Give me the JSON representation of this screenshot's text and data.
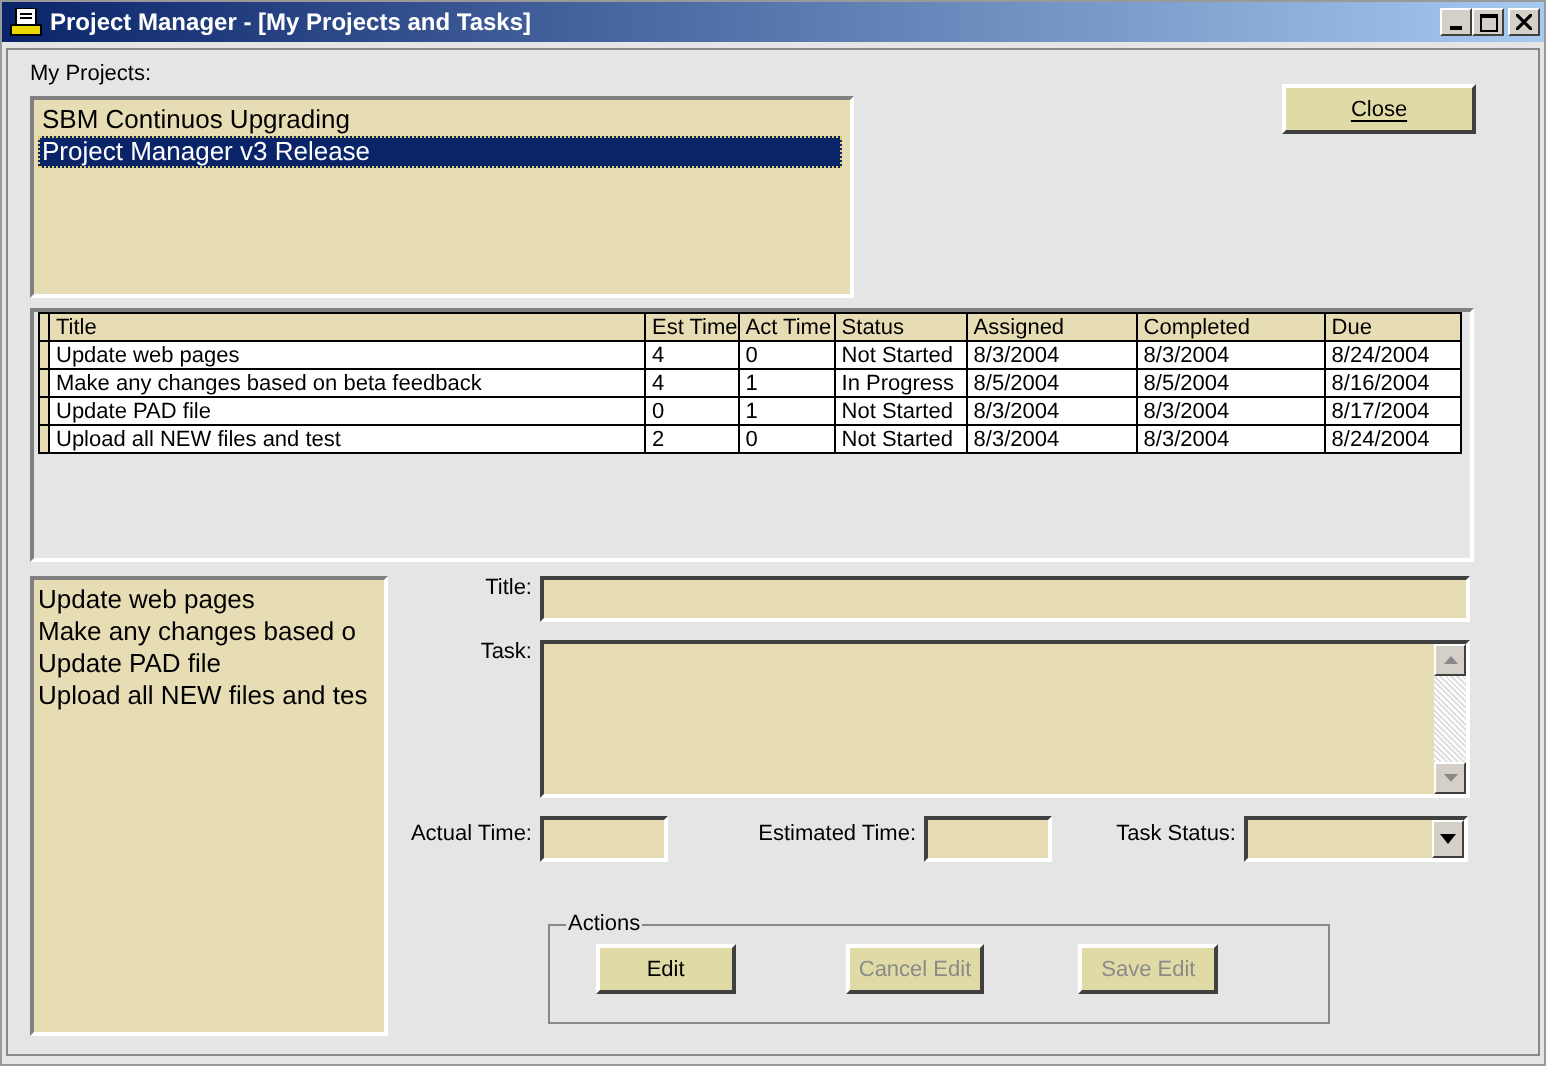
{
  "window": {
    "title": "Project Manager - [My Projects and Tasks]"
  },
  "projects": {
    "label": "My Projects:",
    "items": [
      {
        "name": "SBM Continuos Upgrading",
        "selected": false
      },
      {
        "name": "Project Manager v3 Release",
        "selected": true
      }
    ]
  },
  "close_button": {
    "label": "Close"
  },
  "table": {
    "columns": [
      "Title",
      "Est Time",
      "Act Time",
      "Status",
      "Assigned",
      "Completed",
      "Due"
    ],
    "rows": [
      [
        "Update web pages",
        "4",
        "0",
        "Not Started",
        "8/3/2004",
        "8/3/2004",
        "8/24/2004"
      ],
      [
        "Make any changes based on beta feedback",
        "4",
        "1",
        "In Progress",
        "8/5/2004",
        "8/5/2004",
        "8/16/2004"
      ],
      [
        "Update PAD file",
        "0",
        "1",
        "Not Started",
        "8/3/2004",
        "8/3/2004",
        "8/17/2004"
      ],
      [
        "Upload all NEW files and test",
        "2",
        "0",
        "Not Started",
        "8/3/2004",
        "8/3/2004",
        "8/24/2004"
      ]
    ]
  },
  "task_list": [
    "Update web pages",
    "Make any changes based o",
    "Update PAD file",
    "Upload all NEW files and tes"
  ],
  "form": {
    "title_label": "Title:",
    "task_label": "Task:",
    "actual_time_label": "Actual Time:",
    "estimated_time_label": "Estimated Time:",
    "task_status_label": "Task Status:"
  },
  "actions": {
    "legend": "Actions",
    "buttons": [
      {
        "label": "Edit",
        "disabled": false
      },
      {
        "label": "Cancel Edit",
        "disabled": true
      },
      {
        "label": "Save Edit",
        "disabled": true
      }
    ]
  }
}
